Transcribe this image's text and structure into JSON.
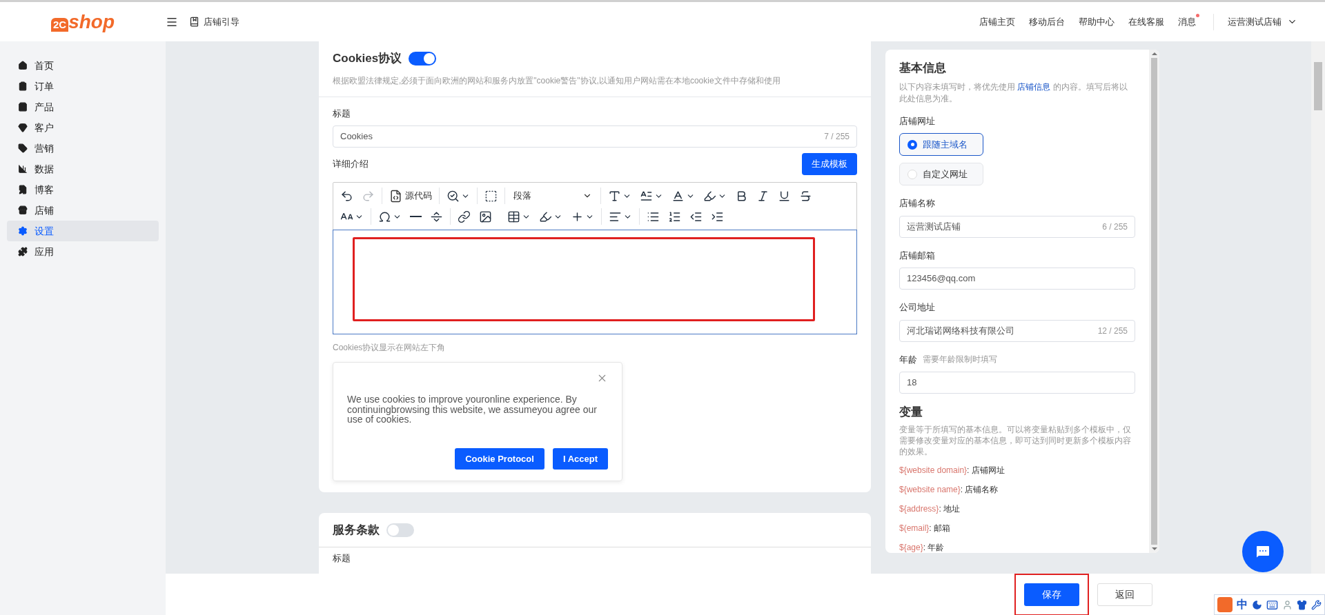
{
  "logo": {
    "mark": "2C",
    "text": "shop"
  },
  "header": {
    "guide_label": "店铺引导",
    "links": [
      "店铺主页",
      "移动后台",
      "帮助中心",
      "在线客服"
    ],
    "messages": {
      "label": "消息",
      "unread": true
    },
    "store": "运营测试店铺"
  },
  "sidebar": {
    "items": [
      {
        "label": "首页",
        "selected": false
      },
      {
        "label": "订单",
        "selected": false
      },
      {
        "label": "产品",
        "selected": false
      },
      {
        "label": "客户",
        "selected": false
      },
      {
        "label": "营销",
        "selected": false
      },
      {
        "label": "数据",
        "selected": false
      },
      {
        "label": "博客",
        "selected": false
      },
      {
        "label": "店铺",
        "selected": false
      },
      {
        "label": "设置",
        "selected": true
      },
      {
        "label": "应用",
        "selected": false
      }
    ]
  },
  "cookie_section": {
    "title": "Cookies协议",
    "on": true,
    "description": "根据欧盟法律规定,必须于面向欧洲的网站和服务内放置\"cookie警告\"协议,以通知用户网站需在本地cookie文件中存储和使用",
    "title_label": "标题",
    "title_value": "Cookies",
    "title_count": "7 / 255",
    "detail_label": "详细介绍",
    "generate_button": "生成模板",
    "editor": {
      "source_code": "源代码",
      "block_format": "段落",
      "redo_disabled": true,
      "highlighted": true
    },
    "hint": "Cookies协议显示在网站左下角",
    "preview": {
      "text": "We use cookies to improve youronline experience. By continuingbrowsing this website, we assumeyou agree our use of cookies.",
      "buttons": [
        "Cookie Protocol",
        "I Accept"
      ]
    }
  },
  "terms_section": {
    "title": "服务条款",
    "on": false,
    "title_label": "标题"
  },
  "basic_info": {
    "title": "基本信息",
    "intro_before": "以下内容未填写时，将优先使用 ",
    "intro_link": "店铺信息",
    "intro_after": " 的内容。填写后将以此处信息为准。",
    "url_label": "店铺网址",
    "url_options": [
      {
        "label": "跟随主域名",
        "selected": true
      },
      {
        "label": "自定义网址",
        "selected": false
      }
    ],
    "fields": [
      {
        "label": "店铺名称",
        "value": "运营测试店铺",
        "count": "6 / 255"
      },
      {
        "label": "店铺邮箱",
        "value": "123456@qq.com"
      },
      {
        "label": "公司地址",
        "value": "河北瑞诺网络科技有限公司",
        "count": "12 / 255"
      },
      {
        "label": "年龄",
        "hint": "需要年龄限制时填写",
        "value": "18"
      }
    ]
  },
  "variables": {
    "title": "变量",
    "description": "变量等于所填写的基本信息。可以将变量粘贴到多个模板中，仅需要修改变量对应的基本信息，即可达到同时更新多个模板内容的效果。",
    "items": [
      {
        "code": "${website domain}",
        "text": ": 店铺网址"
      },
      {
        "code": "${website name}",
        "text": ": 店铺名称"
      },
      {
        "code": "${address}",
        "text": ": 地址"
      },
      {
        "code": "$(email}",
        "text": ": 邮箱"
      },
      {
        "code": "${age}",
        "text": ": 年龄"
      }
    ]
  },
  "footer": {
    "buttons": [
      {
        "label": "保存",
        "kind": "primary",
        "highlighted": true
      },
      {
        "label": "返回",
        "kind": "secondary",
        "highlighted": false
      }
    ]
  },
  "ime_toolbar": {
    "mode": "中"
  }
}
